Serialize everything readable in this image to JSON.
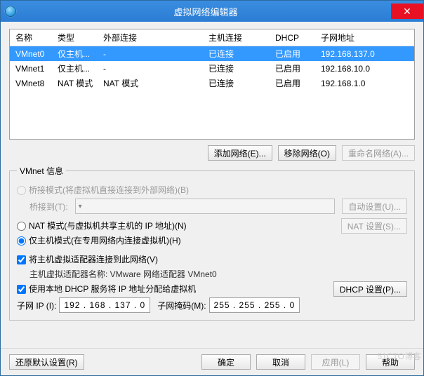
{
  "window": {
    "title": "虚拟网络编辑器"
  },
  "table": {
    "headers": [
      "名称",
      "类型",
      "外部连接",
      "主机连接",
      "DHCP",
      "子网地址"
    ],
    "rows": [
      {
        "name": "VMnet0",
        "type": "仅主机...",
        "ext": "-",
        "host": "已连接",
        "dhcp": "已启用",
        "subnet": "192.168.137.0",
        "selected": true
      },
      {
        "name": "VMnet1",
        "type": "仅主机...",
        "ext": "-",
        "host": "已连接",
        "dhcp": "已启用",
        "subnet": "192.168.10.0",
        "selected": false
      },
      {
        "name": "VMnet8",
        "type": "NAT 模式",
        "ext": "NAT 模式",
        "host": "已连接",
        "dhcp": "已启用",
        "subnet": "192.168.1.0",
        "selected": false
      }
    ]
  },
  "buttons": {
    "add": "添加网络(E)...",
    "remove": "移除网络(O)",
    "rename": "重命名网络(A)...",
    "autoset": "自动设置(U)...",
    "natset": "NAT 设置(S)...",
    "dhcpset": "DHCP 设置(P)...",
    "restore": "还原默认设置(R)",
    "ok": "确定",
    "cancel": "取消",
    "apply": "应用(L)",
    "help": "帮助"
  },
  "info": {
    "legend": "VMnet 信息",
    "bridge_label": "桥接模式(将虚拟机直接连接到外部网络)(B)",
    "bridge_to": "桥接到(T):",
    "nat_label": "NAT 模式(与虚拟机共享主机的 IP 地址)(N)",
    "host_label": "仅主机模式(在专用网络内连接虚拟机)(H)",
    "connect_host": "将主机虚拟适配器连接到此网络(V)",
    "adapter_name": "主机虚拟适配器名称: VMware 网络适配器 VMnet0",
    "use_dhcp": "使用本地 DHCP 服务将 IP 地址分配给虚拟机",
    "subnet_ip_label": "子网 IP (I):",
    "subnet_ip": "192 . 168 . 137 . 0",
    "mask_label": "子网掩码(M):",
    "mask": "255 . 255 . 255 . 0"
  },
  "watermark": "51CTO博客"
}
